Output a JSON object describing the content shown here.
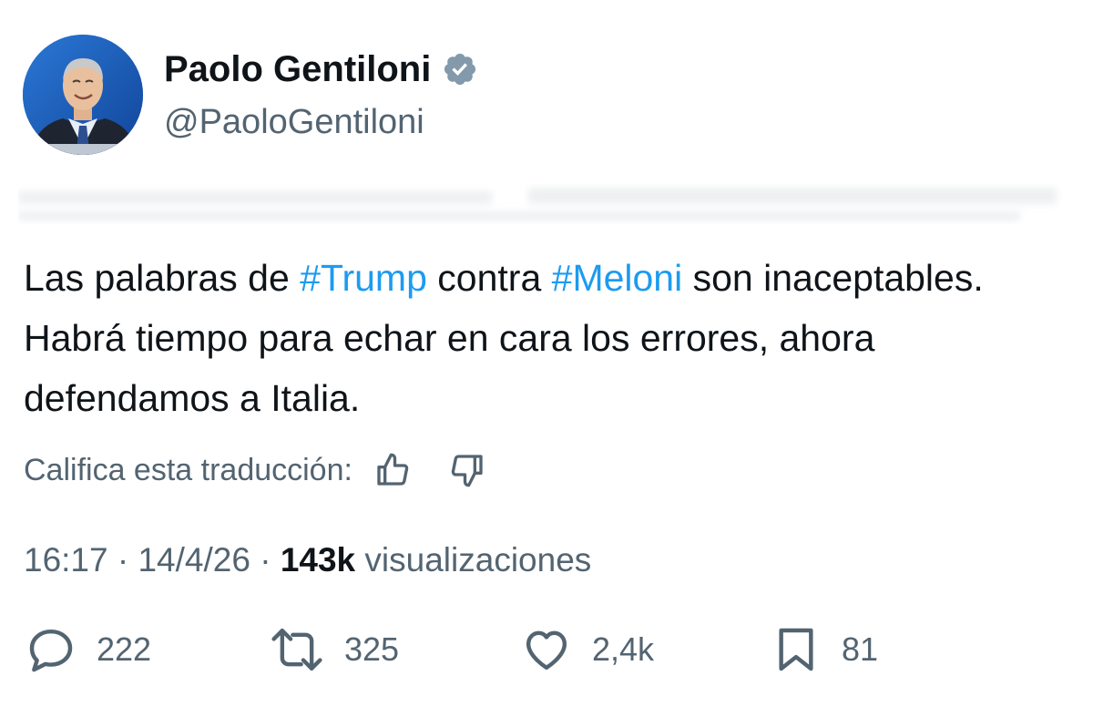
{
  "author": {
    "display_name": "Paolo Gentiloni",
    "handle": "@PaoloGentiloni",
    "verified": true,
    "verified_color": "#829aab"
  },
  "tweet": {
    "text_part1": "Las palabras de ",
    "hashtag1": "#Trump",
    "text_part2": " contra ",
    "hashtag2": "#Meloni",
    "text_part3": " son inaceptables. Habrá tiempo para echar en cara los errores, ahora defendamos a Italia.",
    "hashtag_color": "#1d9bf0"
  },
  "translation_rating": {
    "label": "Califica esta traducción:",
    "like_icon": "thumbs-up-icon",
    "dislike_icon": "thumbs-down-icon"
  },
  "meta": {
    "time": "16:17",
    "separator": "·",
    "date": "14/4/26",
    "views_count": "143k",
    "views_label": "visualizaciones"
  },
  "actions": {
    "replies": "222",
    "reposts": "325",
    "likes": "2,4k",
    "bookmarks": "81"
  },
  "colors": {
    "text_primary": "#0f1419",
    "text_secondary": "#536471",
    "accent": "#1d9bf0"
  }
}
